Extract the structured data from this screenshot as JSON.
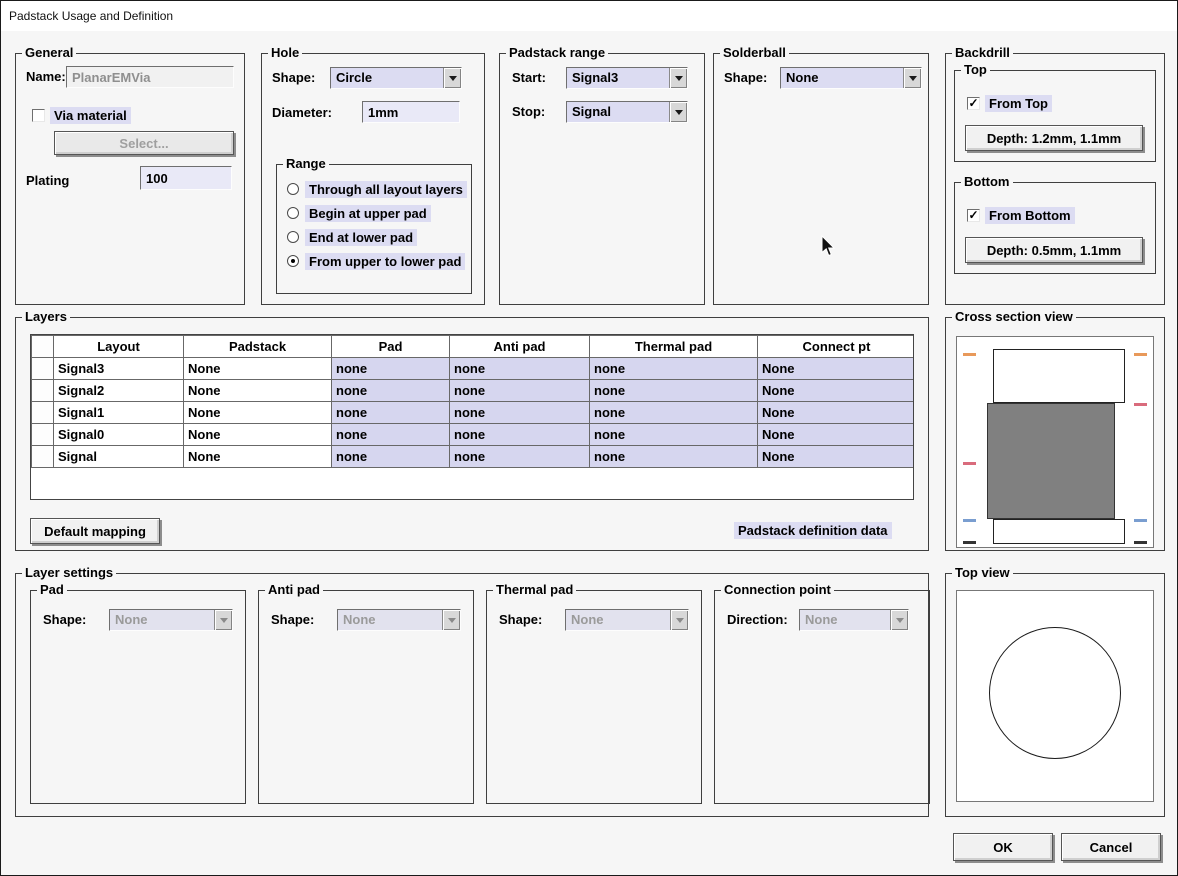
{
  "window": {
    "title": "Padstack Usage and Definition"
  },
  "colors": {
    "label_highlight": "#dcdcf2",
    "table_cell_highlight": "#d6d6ef",
    "via_barrel_fill": "#808080",
    "marker_orange": "#e8995a",
    "marker_pink": "#d96b7c",
    "marker_blue": "#7a9ed0",
    "marker_black": "#333333"
  },
  "general": {
    "title": "General",
    "name_label": "Name:",
    "name_value": "PlanarEMVia",
    "via_material_label": "Via material",
    "via_material_checked": false,
    "select_button_label": "Select...",
    "plating_label": "Plating",
    "plating_value": "100"
  },
  "hole": {
    "title": "Hole",
    "shape_label": "Shape:",
    "shape_value": "Circle",
    "diameter_label": "Diameter:",
    "diameter_value": "1mm",
    "range": {
      "title": "Range",
      "options": [
        {
          "label": "Through all layout layers",
          "selected": false
        },
        {
          "label": "Begin at upper pad",
          "selected": false
        },
        {
          "label": "End at lower pad",
          "selected": false
        },
        {
          "label": "From upper to lower pad",
          "selected": true
        }
      ]
    }
  },
  "padstack_range": {
    "title": "Padstack range",
    "start_label": "Start:",
    "start_value": "Signal3",
    "stop_label": "Stop:",
    "stop_value": "Signal"
  },
  "solderball": {
    "title": "Solderball",
    "shape_label": "Shape:",
    "shape_value": "None"
  },
  "backdrill": {
    "title": "Backdrill",
    "top": {
      "title": "Top",
      "checkbox_label": "From Top",
      "checked": true,
      "depth_button_label": "Depth: 1.2mm, 1.1mm"
    },
    "bottom": {
      "title": "Bottom",
      "checkbox_label": "From Bottom",
      "checked": true,
      "depth_button_label": "Depth: 0.5mm, 1.1mm"
    }
  },
  "layers": {
    "title": "Layers",
    "columns": [
      "Layout",
      "Padstack",
      "Pad",
      "Anti pad",
      "Thermal pad",
      "Connect pt"
    ],
    "rows": [
      [
        "Signal3",
        "None",
        "none",
        "none",
        "none",
        "None"
      ],
      [
        "Signal2",
        "None",
        "none",
        "none",
        "none",
        "None"
      ],
      [
        "Signal1",
        "None",
        "none",
        "none",
        "none",
        "None"
      ],
      [
        "Signal0",
        "None",
        "none",
        "none",
        "none",
        "None"
      ],
      [
        "Signal",
        "None",
        "none",
        "none",
        "none",
        "None"
      ]
    ],
    "default_mapping_button_label": "Default mapping",
    "padstack_definition_label": "Padstack definition data"
  },
  "cross_section_view": {
    "title": "Cross section view"
  },
  "layer_settings": {
    "title": "Layer settings",
    "pad": {
      "title": "Pad",
      "shape_label": "Shape:",
      "shape_value": "None"
    },
    "anti_pad": {
      "title": "Anti pad",
      "shape_label": "Shape:",
      "shape_value": "None"
    },
    "thermal_pad": {
      "title": "Thermal pad",
      "shape_label": "Shape:",
      "shape_value": "None"
    },
    "connection_point": {
      "title": "Connection point",
      "direction_label": "Direction:",
      "direction_value": "None"
    }
  },
  "top_view": {
    "title": "Top view"
  },
  "footer": {
    "ok_label": "OK",
    "cancel_label": "Cancel"
  }
}
